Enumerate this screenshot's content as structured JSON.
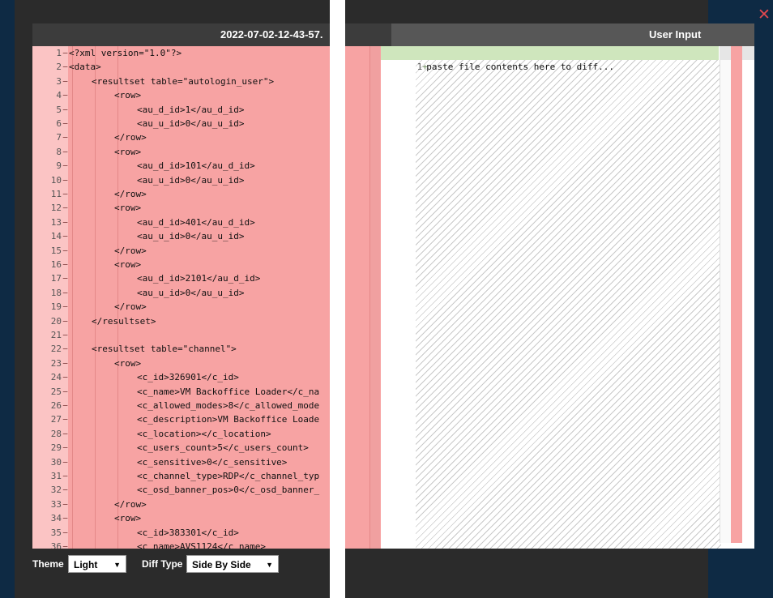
{
  "window": {
    "close_label": "✕"
  },
  "left_pane": {
    "title": "2022-07-02-12-43-57.",
    "lines": [
      {
        "n": "1",
        "t": "<?xml version=\"1.0\"?>",
        "d": 0
      },
      {
        "n": "2",
        "t": "<data>",
        "d": 0
      },
      {
        "n": "3",
        "t": "<resultset table=\"autologin_user\">",
        "d": 1
      },
      {
        "n": "4",
        "t": "<row>",
        "d": 2
      },
      {
        "n": "5",
        "t": "<au_d_id>1</au_d_id>",
        "d": 3
      },
      {
        "n": "6",
        "t": "<au_u_id>0</au_u_id>",
        "d": 3
      },
      {
        "n": "7",
        "t": "</row>",
        "d": 2
      },
      {
        "n": "8",
        "t": "<row>",
        "d": 2
      },
      {
        "n": "9",
        "t": "<au_d_id>101</au_d_id>",
        "d": 3
      },
      {
        "n": "10",
        "t": "<au_u_id>0</au_u_id>",
        "d": 3
      },
      {
        "n": "11",
        "t": "</row>",
        "d": 2
      },
      {
        "n": "12",
        "t": "<row>",
        "d": 2
      },
      {
        "n": "13",
        "t": "<au_d_id>401</au_d_id>",
        "d": 3
      },
      {
        "n": "14",
        "t": "<au_u_id>0</au_u_id>",
        "d": 3
      },
      {
        "n": "15",
        "t": "</row>",
        "d": 2
      },
      {
        "n": "16",
        "t": "<row>",
        "d": 2
      },
      {
        "n": "17",
        "t": "<au_d_id>2101</au_d_id>",
        "d": 3
      },
      {
        "n": "18",
        "t": "<au_u_id>0</au_u_id>",
        "d": 3
      },
      {
        "n": "19",
        "t": "</row>",
        "d": 2
      },
      {
        "n": "20",
        "t": "</resultset>",
        "d": 1
      },
      {
        "n": "21",
        "t": "",
        "d": 0
      },
      {
        "n": "22",
        "t": "<resultset table=\"channel\">",
        "d": 1
      },
      {
        "n": "23",
        "t": "<row>",
        "d": 2
      },
      {
        "n": "24",
        "t": "<c_id>326901</c_id>",
        "d": 3
      },
      {
        "n": "25",
        "t": "<c_name>VM Backoffice Loader</c_na",
        "d": 3
      },
      {
        "n": "26",
        "t": "<c_allowed_modes>8</c_allowed_mode",
        "d": 3
      },
      {
        "n": "27",
        "t": "<c_description>VM Backoffice Loade",
        "d": 3
      },
      {
        "n": "28",
        "t": "<c_location></c_location>",
        "d": 3
      },
      {
        "n": "29",
        "t": "<c_users_count>5</c_users_count>",
        "d": 3
      },
      {
        "n": "30",
        "t": "<c_sensitive>0</c_sensitive>",
        "d": 3
      },
      {
        "n": "31",
        "t": "<c_channel_type>RDP</c_channel_typ",
        "d": 3
      },
      {
        "n": "32",
        "t": "<c_osd_banner_pos>0</c_osd_banner_",
        "d": 3
      },
      {
        "n": "33",
        "t": "</row>",
        "d": 2
      },
      {
        "n": "34",
        "t": "<row>",
        "d": 2
      },
      {
        "n": "35",
        "t": "<c_id>383301</c_id>",
        "d": 3
      },
      {
        "n": "36",
        "t": "<c_name>AVS1124</c_name>",
        "d": 3
      }
    ]
  },
  "right_pane": {
    "title": "User Input",
    "line_number": "1",
    "line_marker": "+",
    "placeholder_line": "paste file contents here to diff..."
  },
  "controls": {
    "theme_label": "Theme",
    "theme_value": "Light",
    "diff_type_label": "Diff Type",
    "diff_type_value": "Side By Side"
  },
  "colors": {
    "removed": "#f7a3a3",
    "added": "#cfe6bd",
    "close": "#e0484f"
  }
}
